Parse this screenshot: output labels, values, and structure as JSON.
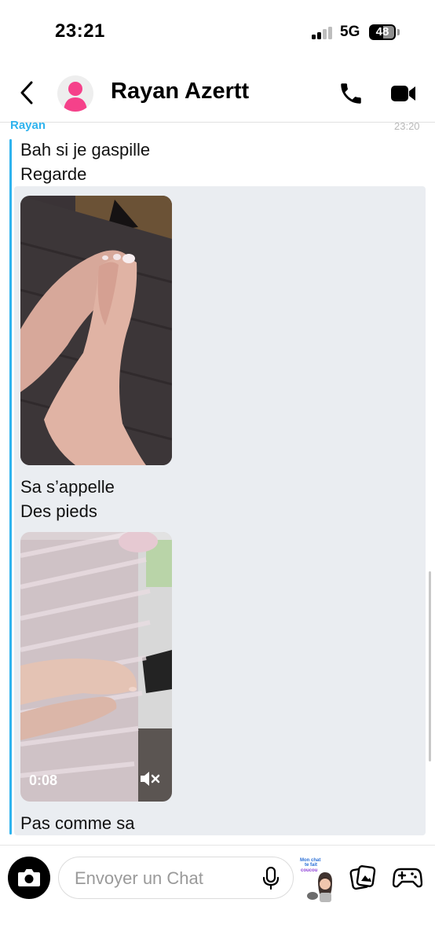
{
  "status_bar": {
    "time": "23:21",
    "network": "5G",
    "battery": "48"
  },
  "header": {
    "contact_name": "Rayan Azertt",
    "icons": [
      "back-icon",
      "avatar-icon",
      "phone-icon",
      "video-camera-icon"
    ]
  },
  "chat": {
    "sender": "Rayan",
    "time": "23:20",
    "accent_color": "#2fb3ee",
    "messages": [
      "Bah si je gaspille",
      "Regarde",
      "Sa s’appelle",
      "Des pieds",
      "Pas comme sa"
    ],
    "video": {
      "duration": "0:08",
      "muted": true
    }
  },
  "input_bar": {
    "placeholder": "Envoyer un Chat",
    "bitmoji_text": "Mon chat te fait coucou"
  }
}
